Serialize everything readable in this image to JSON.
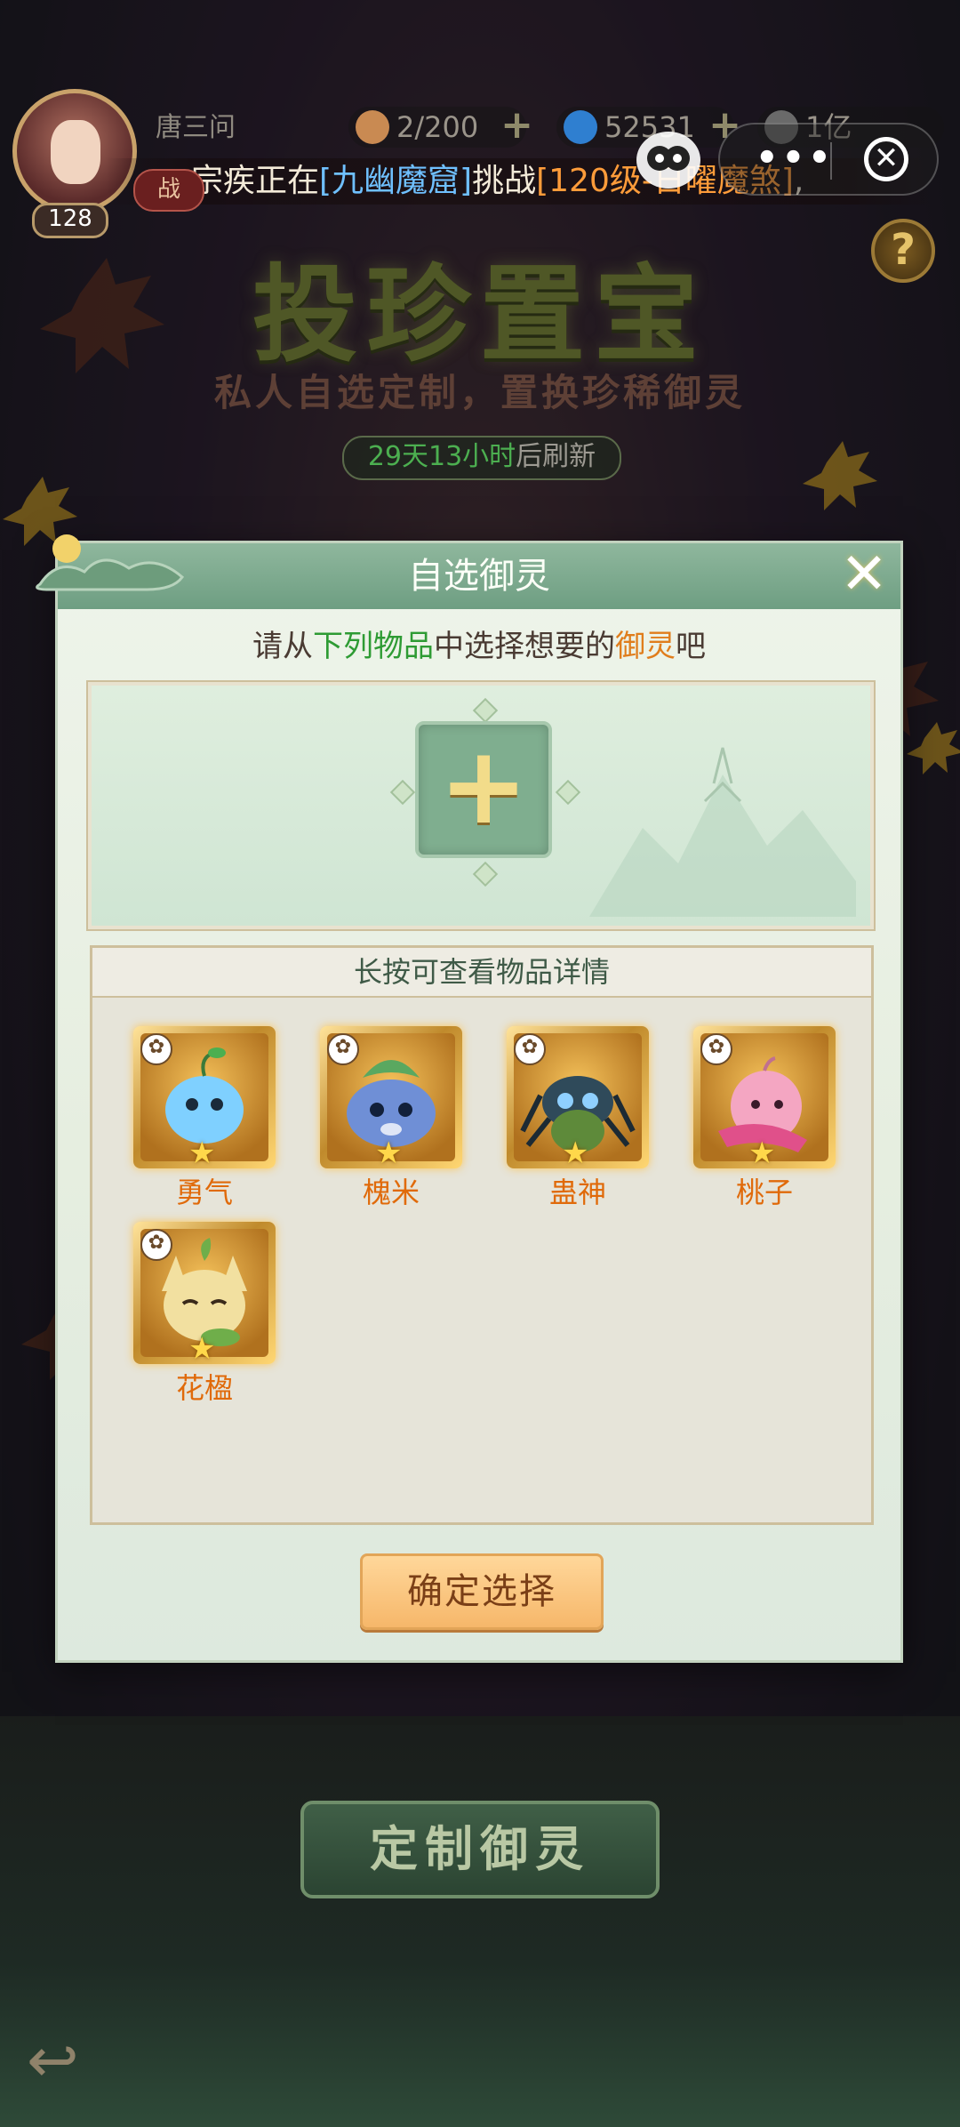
{
  "hud": {
    "player_name": "唐三问",
    "level": "128",
    "battle_tag": "战",
    "stamina": "2/200",
    "gold": "52531",
    "currency": "1亿"
  },
  "ticker": {
    "part1": "宗疾正在",
    "part2": "[九幽魔窟]",
    "part3": "挑战",
    "part4": "[120级-日曜魔煞]",
    "part5": ","
  },
  "capsule": {
    "more": "•••",
    "close": "✕"
  },
  "help": "?",
  "event": {
    "title": "投珍置宝",
    "subtitle": "私人自选定制，置换珍稀御灵",
    "refresh_highlight": "29天13小时",
    "refresh_suffix": "后刷新"
  },
  "dialog": {
    "title": "自选御灵",
    "close": "✕",
    "prompt_a": "请从",
    "prompt_b": "下列物品",
    "prompt_c": "中选择想要的",
    "prompt_d": "御灵",
    "prompt_e": "吧",
    "slot_plus": "+",
    "list_header": "长按可查看物品详情",
    "items": [
      {
        "name": "勇气",
        "color": "#7fd0ff"
      },
      {
        "name": "槐米",
        "color": "#6f8fd6"
      },
      {
        "name": "蛊神",
        "color": "#3a5a6a"
      },
      {
        "name": "桃子",
        "color": "#f4a6c2"
      },
      {
        "name": "花楹",
        "color": "#f2e0a0"
      }
    ],
    "confirm": "确定选择"
  },
  "bottom": {
    "custom_button": "定制御灵",
    "back": "↩"
  },
  "colors": {
    "accent_green": "#2e9b34",
    "accent_orange": "#e07d1c",
    "header_green": "#6e9e82",
    "gold": "#ffd773"
  }
}
